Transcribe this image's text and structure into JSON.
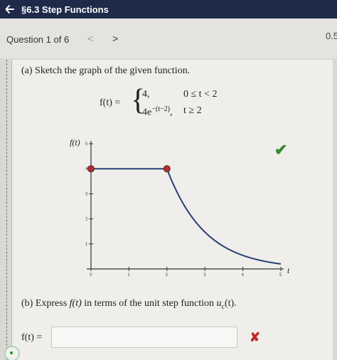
{
  "header": {
    "title": "§6.3 Step Functions",
    "back_icon": "arrow-left-icon"
  },
  "question_bar": {
    "label": "Question 1 of 6",
    "prev": "<",
    "next": ">",
    "score": "0.5"
  },
  "part_a": {
    "prompt": "(a) Sketch the graph of the given function.",
    "lhs": "f(t) =",
    "case1_value": "4,",
    "case1_condition": "0 ≤ t < 2",
    "case2_value_base": "4e",
    "case2_value_exp": "−(t−2)",
    "case2_value_suffix": ",",
    "case2_condition": "t ≥ 2",
    "status_icon": "checkmark-icon",
    "status_color": "#2e8a2e"
  },
  "chart_data": {
    "type": "line",
    "ylabel": "f(t)",
    "xlabel": "t",
    "x_ticks": [
      "0",
      "1",
      "2",
      "3",
      "4",
      "5"
    ],
    "y_ticks": [
      "1",
      "2",
      "3",
      "4",
      "5"
    ],
    "xlim": [
      0,
      5
    ],
    "ylim": [
      0,
      5
    ],
    "series": [
      {
        "x": [
          0,
          2
        ],
        "y": [
          4,
          4
        ]
      },
      {
        "function": "4*exp(-(t-2))",
        "x": [
          2,
          5
        ]
      }
    ],
    "points": [
      {
        "x": 0,
        "y": 4,
        "color": "#c0282b"
      },
      {
        "x": 2,
        "y": 4,
        "color": "#c0282b"
      }
    ],
    "line_color": "#2a3f73"
  },
  "part_b": {
    "prompt_prefix": "(b) Express ",
    "prompt_f": "f(t)",
    "prompt_middle": " in terms of the unit step function ",
    "prompt_u": "u",
    "prompt_u_sub": "c",
    "prompt_u_arg": "(t).",
    "answer_label": "f(t) =",
    "answer_value": "",
    "status_icon": "x-icon",
    "status_color": "#c0282b"
  }
}
